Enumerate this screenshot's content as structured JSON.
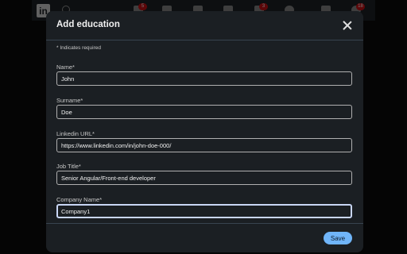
{
  "navbar": {
    "logo_text": "in",
    "badges": {
      "home": "5",
      "notifications": "3",
      "premium": "18"
    }
  },
  "modal": {
    "title": "Add education",
    "close_icon": "close-icon",
    "required_note": "* Indicates required",
    "fields": [
      {
        "label": "Name*",
        "value": "John"
      },
      {
        "label": "Surname*",
        "value": "Doe"
      },
      {
        "label": "Linkedin URL*",
        "value": "https://www.linkedin.com/in/john-doe-000/"
      },
      {
        "label": "Job Title*",
        "value": "Senior Angular/Front-end developer"
      },
      {
        "label": "Company Name*",
        "value": "Company1",
        "focused": true
      }
    ],
    "save_label": "Save"
  },
  "colors": {
    "modal_bg": "#1b1f23",
    "accent": "#70b5f9",
    "badge": "#cc1016"
  }
}
